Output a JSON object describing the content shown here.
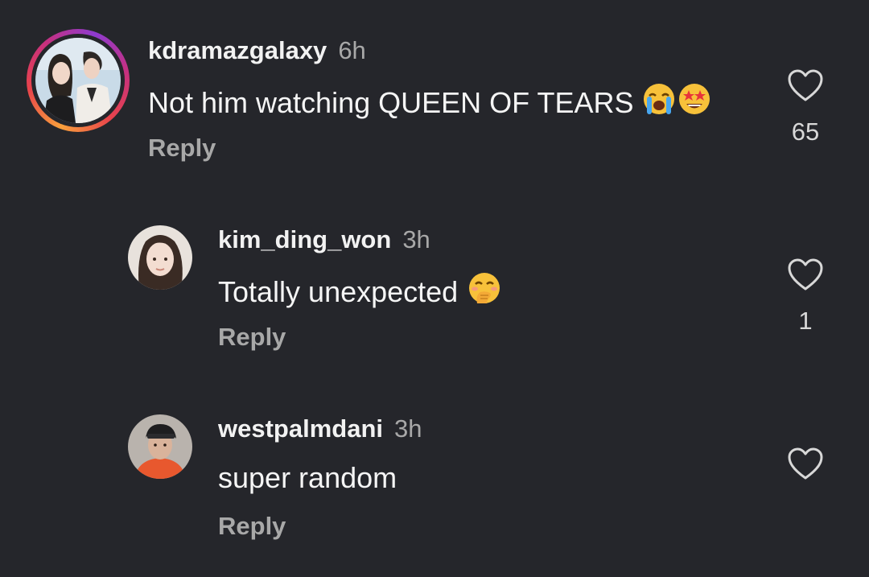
{
  "comments": [
    {
      "username": "kdramazgalaxy",
      "time": "6h",
      "text": "Not him watching QUEEN OF TEARS",
      "emojis": [
        "loudly-crying-face-icon",
        "star-struck-face-icon"
      ],
      "reply_label": "Reply",
      "like_count": "65",
      "has_story": true
    },
    {
      "username": "kim_ding_won",
      "time": "3h",
      "text": "Totally unexpected",
      "emojis": [
        "face-with-hand-over-mouth-icon"
      ],
      "reply_label": "Reply",
      "like_count": "1"
    },
    {
      "username": "westpalmdani",
      "time": "3h",
      "text": "super random",
      "emojis": [],
      "reply_label": "Reply",
      "like_count": ""
    }
  ],
  "colors": {
    "background": "#25262b",
    "username": "#f2f2f2",
    "secondary_text": "#a8a8a8",
    "story_ring_start": "#f9a03c",
    "story_ring_end": "#c6307f"
  }
}
